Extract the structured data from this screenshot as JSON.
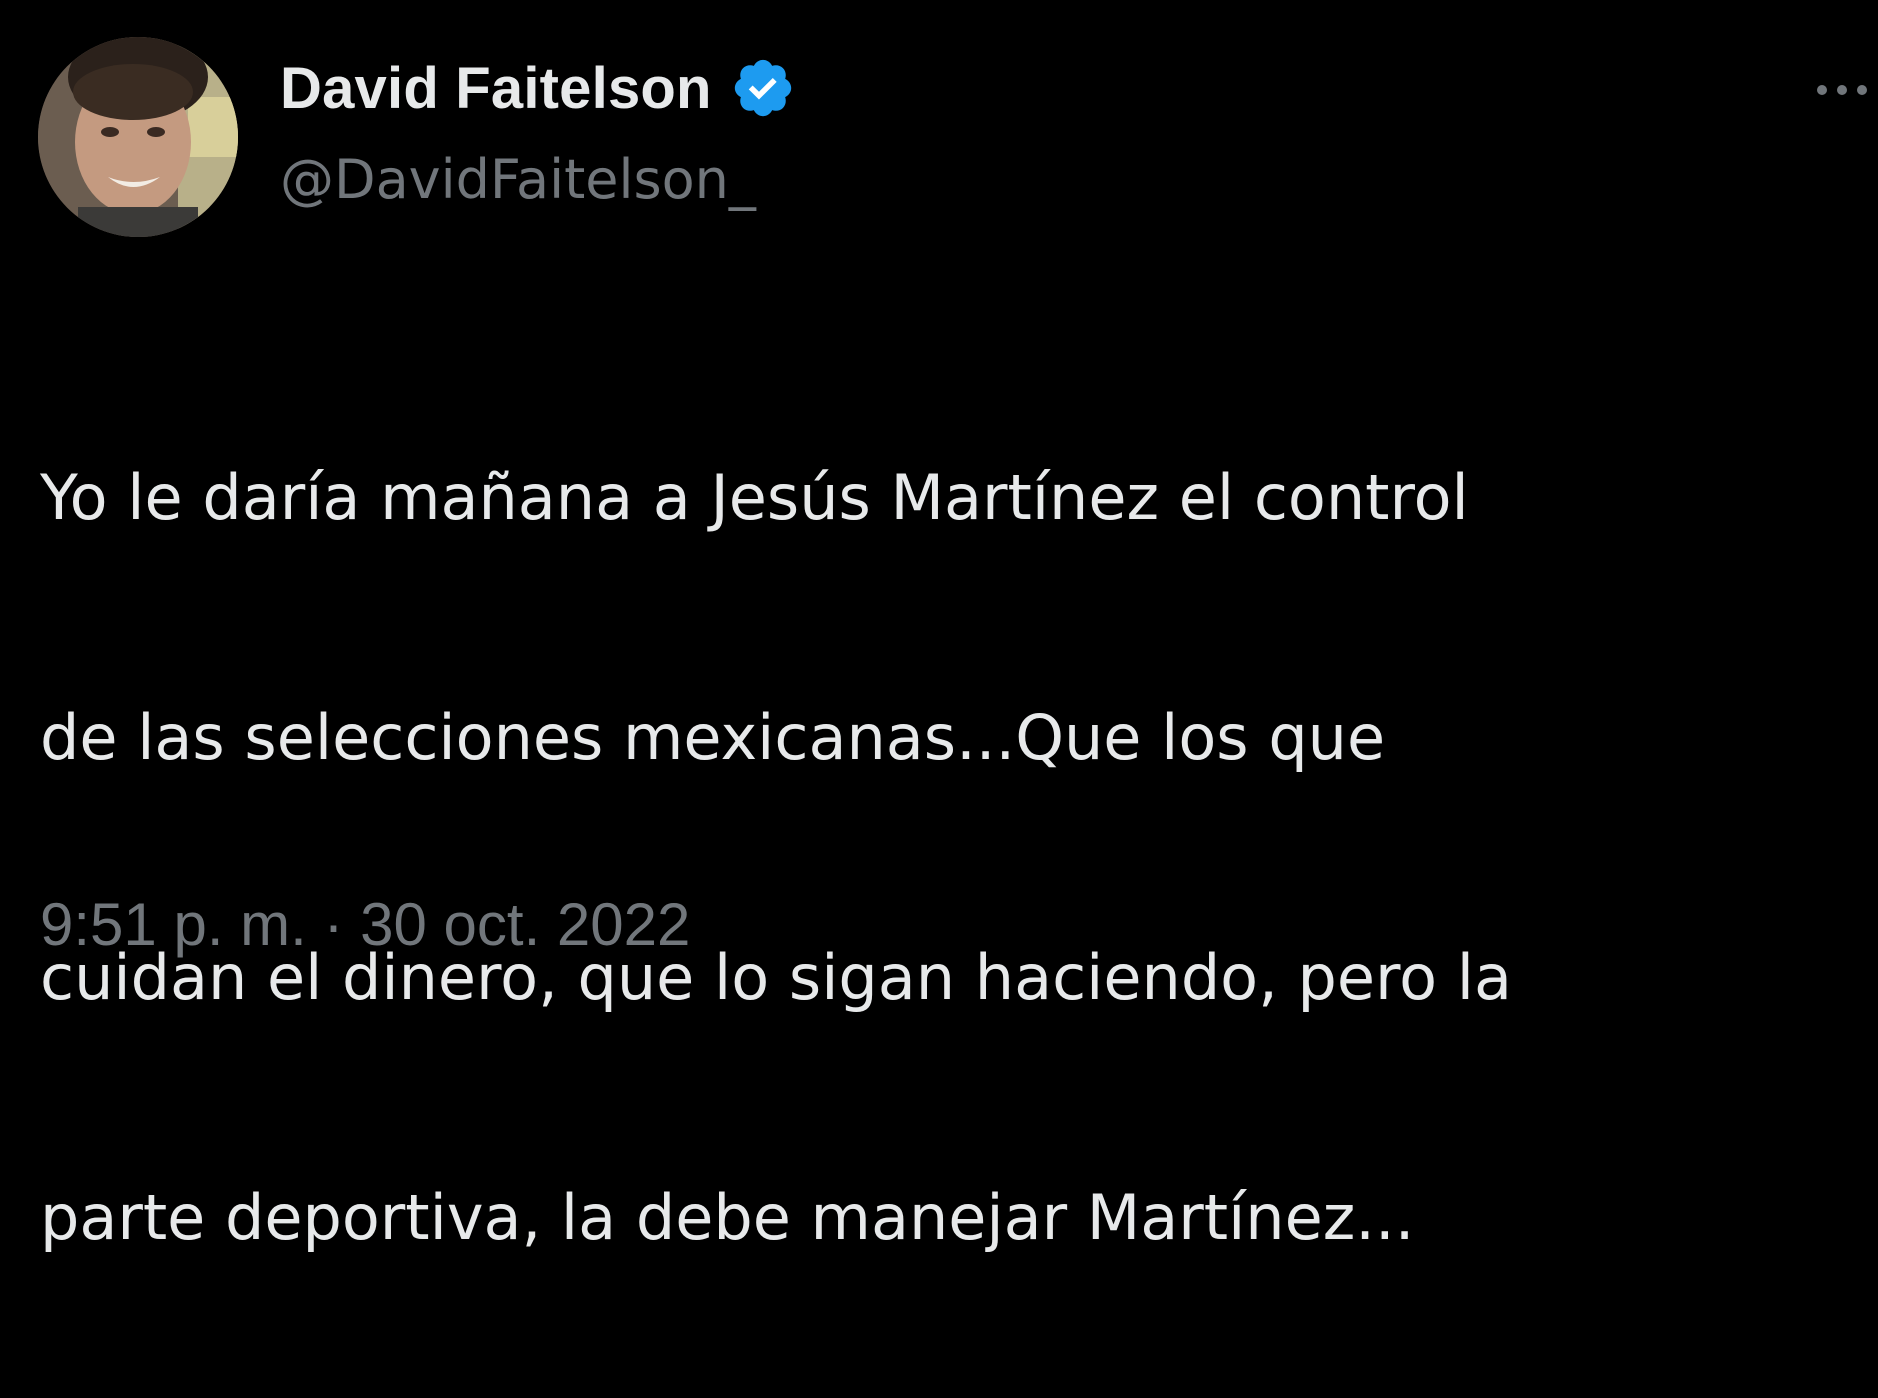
{
  "tweet": {
    "author": {
      "display_name": "David Faitelson",
      "handle": "@DavidFaitelson_",
      "verified": true,
      "avatar_icon": "profile-photo",
      "verified_icon": "verified-badge-icon"
    },
    "text_lines": [
      "Yo le daría mañana a Jesús Martínez el control",
      "de las selecciones mexicanas...Que los que",
      "cuidan el dinero, que lo sigan haciendo, pero la",
      "parte deportiva, la debe manejar Martínez..."
    ],
    "timestamp": "9:51 p. m. · 30 oct. 2022",
    "more_icon": "more-options-icon"
  },
  "colors": {
    "background": "#000000",
    "primary_text": "#e7e9ea",
    "secondary_text": "#71767b",
    "verified_blue": "#1d9bf0"
  }
}
